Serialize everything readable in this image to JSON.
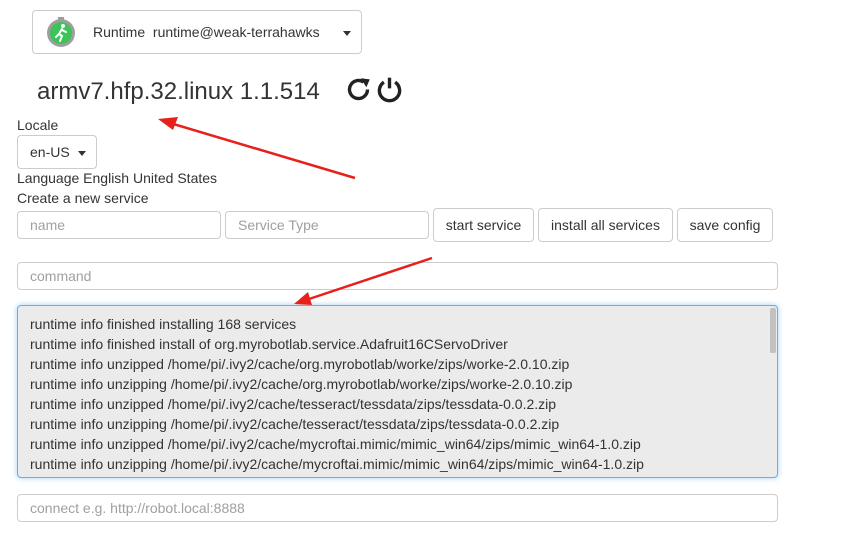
{
  "runtime": {
    "label": "Runtime  runtime@weak-terrahawks",
    "icon": "running-man-icon"
  },
  "version_title": "armv7.hfp.32.linux 1.1.514",
  "icons": {
    "refresh": "refresh-icon",
    "power": "power-icon"
  },
  "locale": {
    "label": "Locale",
    "selected": "en-US",
    "language_text": "Language English United States"
  },
  "create_service": {
    "label": "Create a new service",
    "name_placeholder": "name",
    "type_placeholder": "Service Type",
    "start_label": "start service",
    "install_all_label": "install all services",
    "save_config_label": "save config"
  },
  "command": {
    "placeholder": "command"
  },
  "log": {
    "lines": [
      "runtime info finished installing 168 services",
      "runtime info finished install of org.myrobotlab.service.Adafruit16CServoDriver",
      "runtime info unzipped /home/pi/.ivy2/cache/org.myrobotlab/worke/zips/worke-2.0.10.zip",
      "runtime info unzipping /home/pi/.ivy2/cache/org.myrobotlab/worke/zips/worke-2.0.10.zip",
      "runtime info unzipped /home/pi/.ivy2/cache/tesseract/tessdata/zips/tessdata-0.0.2.zip",
      "runtime info unzipping /home/pi/.ivy2/cache/tesseract/tessdata/zips/tessdata-0.0.2.zip",
      "runtime info unzipped /home/pi/.ivy2/cache/mycroftai.mimic/mimic_win64/zips/mimic_win64-1.0.zip",
      "runtime info unzipping /home/pi/.ivy2/cache/mycroftai.mimic/mimic_win64/zips/mimic_win64-1.0.zip"
    ]
  },
  "connect": {
    "placeholder": "connect e.g. http://robot.local:8888"
  },
  "colors": {
    "annotation_arrow": "#e8201b",
    "focus_border": "#66afe9"
  }
}
